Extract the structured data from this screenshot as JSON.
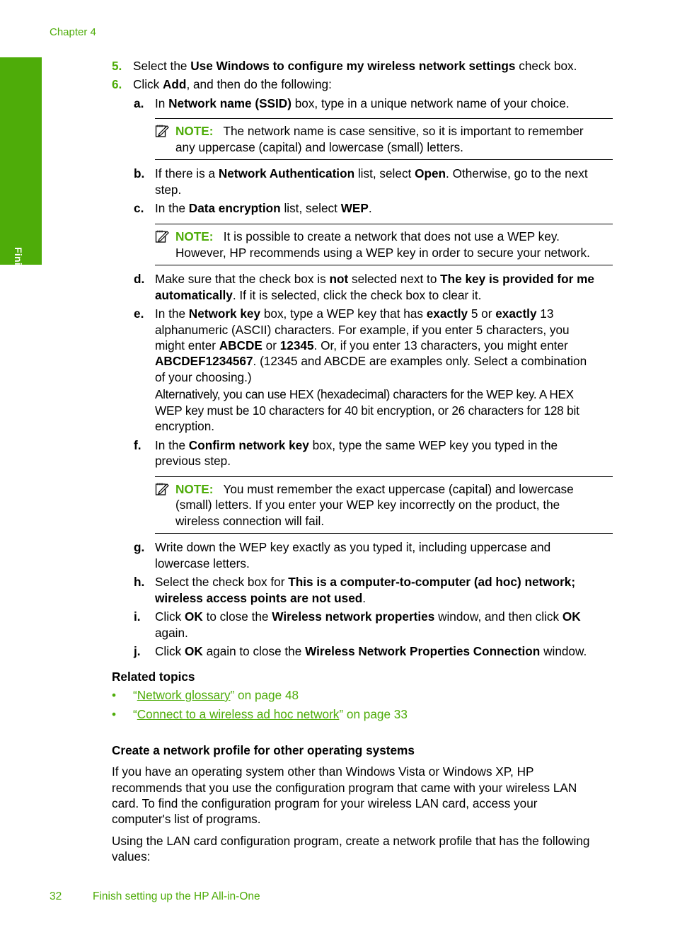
{
  "header": {
    "chapter": "Chapter 4"
  },
  "side_tab": {
    "label": "Finish setup"
  },
  "steps": [
    {
      "num": "5.",
      "parts": [
        "Select the ",
        "Use Windows to configure my wireless network settings",
        " check box."
      ]
    },
    {
      "num": "6.",
      "parts": [
        "Click ",
        "Add",
        ", and then do the following:"
      ]
    }
  ],
  "substeps": {
    "a": {
      "letter": "a",
      "parts": [
        "In ",
        "Network name (SSID)",
        " box, type in a unique network name of your choice."
      ]
    },
    "b": {
      "letter": "b",
      "l1": [
        "If there is a ",
        "Network Authentication",
        " list, select ",
        "Open",
        ". Otherwise, go to the next"
      ],
      "l2": "step."
    },
    "c": {
      "letter": "c",
      "parts": [
        "In the ",
        "Data encryption",
        " list, select ",
        "WEP",
        "."
      ]
    },
    "d": {
      "letter": "d",
      "l1": [
        "Make sure that the check box is ",
        "not",
        " selected next to ",
        "The key is provided for me"
      ],
      "l2": [
        "automatically",
        ". If it is selected, click the check box to clear it."
      ]
    },
    "e": {
      "letter": "e",
      "l1": [
        "In the ",
        "Network key",
        " box, type a WEP key that has ",
        "exactly",
        " 5 or ",
        "exactly",
        " 13"
      ],
      "l2": "alphanumeric (ASCII) characters. For example, if you enter 5 characters, you",
      "l3": [
        "might enter ",
        "ABCDE",
        " or ",
        "12345",
        ". Or, if you enter 13 characters, you might enter"
      ],
      "l4": [
        "ABCDEF1234567",
        ". (12345 and ABCDE are examples only. Select a combination"
      ],
      "l5": "of your choosing.)",
      "l6": "Alternatively, you can use HEX (hexadecimal) characters for the WEP key. A HEX",
      "l7": "WEP key must be 10 characters for 40 bit encryption, or 26 characters for 128 bit",
      "l8": "encryption."
    },
    "f": {
      "letter": "f",
      "l1": [
        "In the ",
        "Confirm network key",
        " box, type the same WEP key you typed in the"
      ],
      "l2": "previous step."
    },
    "g": {
      "letter": "g",
      "l1": "Write down the WEP key exactly as you typed it, including uppercase and",
      "l2": "lowercase letters."
    },
    "h": {
      "letter": "h",
      "l1": [
        "Select the check box for ",
        "This is a computer-to-computer (ad hoc) network;"
      ],
      "l2": [
        "wireless access points are not used",
        "."
      ]
    },
    "i": {
      "letter": "i",
      "l1": [
        "Click ",
        "OK",
        " to close the ",
        "Wireless network properties",
        " window, and then click ",
        "OK"
      ],
      "l2": "again."
    },
    "j": {
      "letter": "j",
      "parts": [
        "Click ",
        "OK",
        " again to close the ",
        "Wireless Network Properties Connection",
        " window."
      ]
    }
  },
  "notes": [
    {
      "label": "NOTE:",
      "l1": "The network name is case sensitive, so it is important to remember",
      "l2": "any uppercase (capital) and lowercase (small) letters."
    },
    {
      "label": "NOTE:",
      "l1": "It is possible to create a network that does not use a WEP key.",
      "l2": "However, HP recommends using a WEP key in order to secure your network."
    },
    {
      "label": "NOTE:",
      "l1": "You must remember the exact uppercase (capital) and lowercase",
      "l2": "(small) letters. If you enter your WEP key incorrectly on the product, the",
      "l3": "wireless connection will fail."
    }
  ],
  "related": {
    "heading": "Related topics",
    "bullet": "•",
    "links": [
      {
        "open": "“",
        "text": "Network glossary",
        "rest": "” on page 48"
      },
      {
        "open": "“",
        "text": "Connect to a wireless ad hoc network",
        "rest": "” on page 33"
      }
    ]
  },
  "section": {
    "heading": "Create a network profile for other operating systems",
    "p1": [
      "If you have an operating system other than Windows Vista or Windows XP, HP",
      "recommends that you use the configuration program that came with your wireless LAN",
      "card. To find the configuration program for your wireless LAN card, access your",
      "computer's list of programs."
    ],
    "p2": [
      "Using the LAN card configuration program, create a network profile that has the following",
      "values:"
    ]
  },
  "footer": {
    "page_number": "32",
    "title": "Finish setting up the HP All-in-One"
  },
  "colors": {
    "accent": "#4eac09",
    "text": "#000000",
    "tab_text": "#ffffff"
  }
}
